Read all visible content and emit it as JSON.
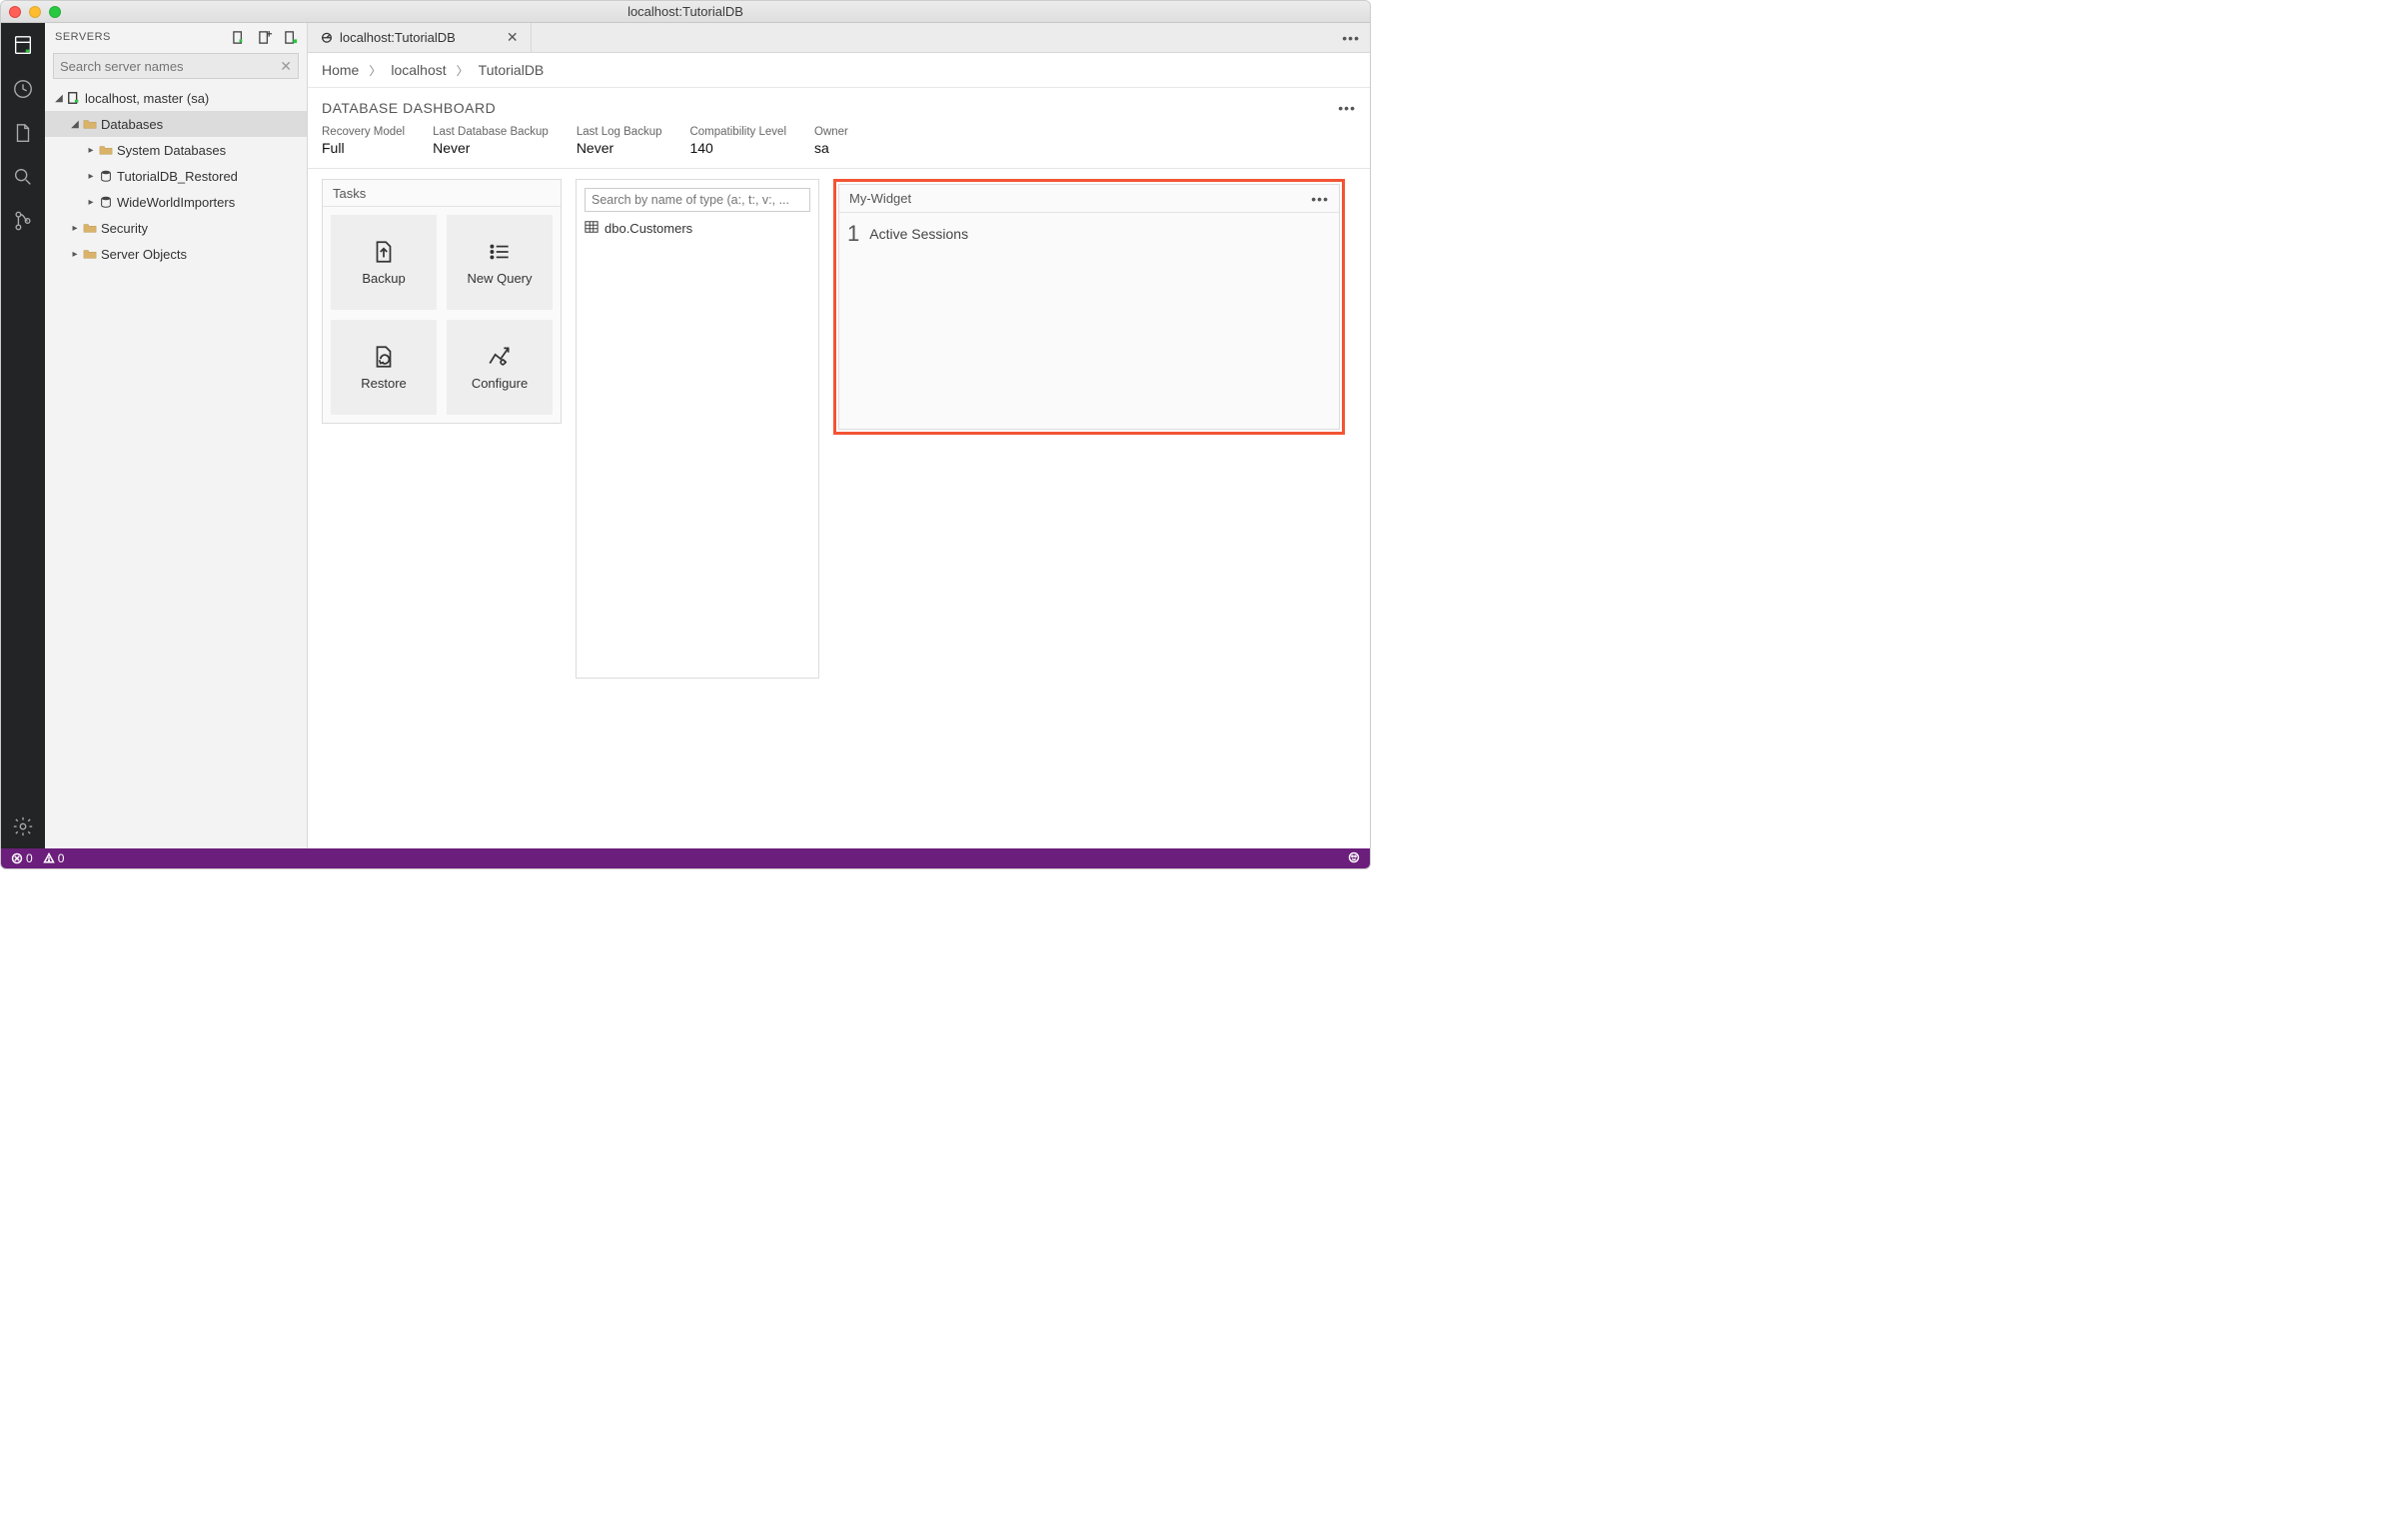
{
  "title": "localhost:TutorialDB",
  "sidebar": {
    "header": "SERVERS",
    "search_placeholder": "Search server names",
    "tree": {
      "server": "localhost, master (sa)",
      "databases": "Databases",
      "sysdb": "System Databases",
      "restored": "TutorialDB_Restored",
      "wwi": "WideWorldImporters",
      "security": "Security",
      "server_objects": "Server Objects"
    }
  },
  "tab": {
    "title": "localhost:TutorialDB"
  },
  "breadcrumb": {
    "b0": "Home",
    "b1": "localhost",
    "b2": "TutorialDB"
  },
  "dashboard": {
    "title": "DATABASE DASHBOARD",
    "metrics": [
      {
        "label": "Recovery Model",
        "value": "Full"
      },
      {
        "label": "Last Database Backup",
        "value": "Never"
      },
      {
        "label": "Last Log Backup",
        "value": "Never"
      },
      {
        "label": "Compatibility Level",
        "value": "140"
      },
      {
        "label": "Owner",
        "value": "sa"
      }
    ]
  },
  "tasks": {
    "header": "Tasks",
    "items": [
      {
        "label": "Backup"
      },
      {
        "label": "New Query"
      },
      {
        "label": "Restore"
      },
      {
        "label": "Configure"
      }
    ]
  },
  "search_widget": {
    "placeholder": "Search by name of type (a:, t:, v:, ...",
    "result": "dbo.Customers"
  },
  "my_widget": {
    "header": "My-Widget",
    "count": "1",
    "label": "Active Sessions"
  },
  "statusbar": {
    "errors": "0",
    "warnings": "0"
  }
}
